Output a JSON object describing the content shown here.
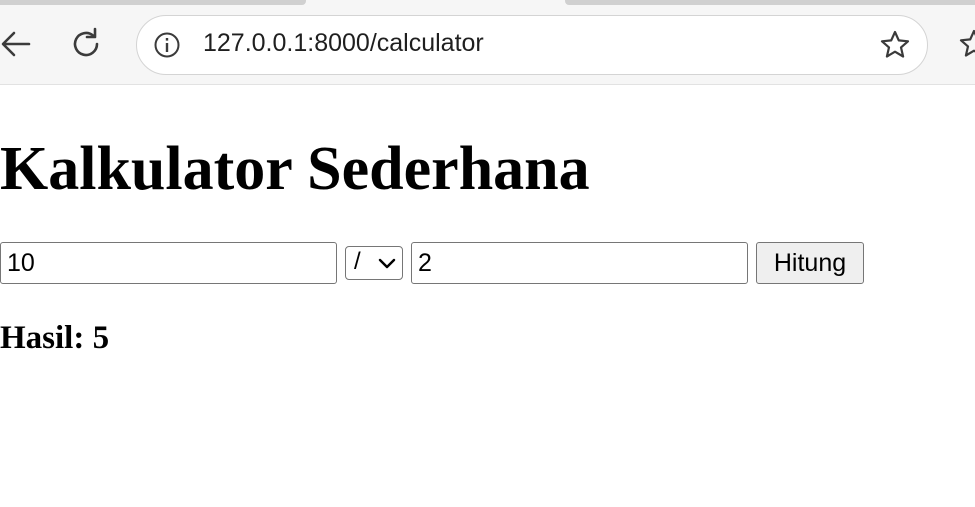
{
  "browser": {
    "url": "127.0.0.1:8000/calculator"
  },
  "page": {
    "title": "Kalkulator Sederhana",
    "form": {
      "num1_value": "10",
      "operator_value": "/",
      "num2_value": "2",
      "submit_label": "Hitung"
    },
    "result": {
      "label": "Hasil:",
      "value": "5"
    }
  },
  "icons": {
    "back": "back-arrow-icon",
    "reload": "reload-icon",
    "info": "info-icon",
    "bookmark": "star-icon"
  }
}
